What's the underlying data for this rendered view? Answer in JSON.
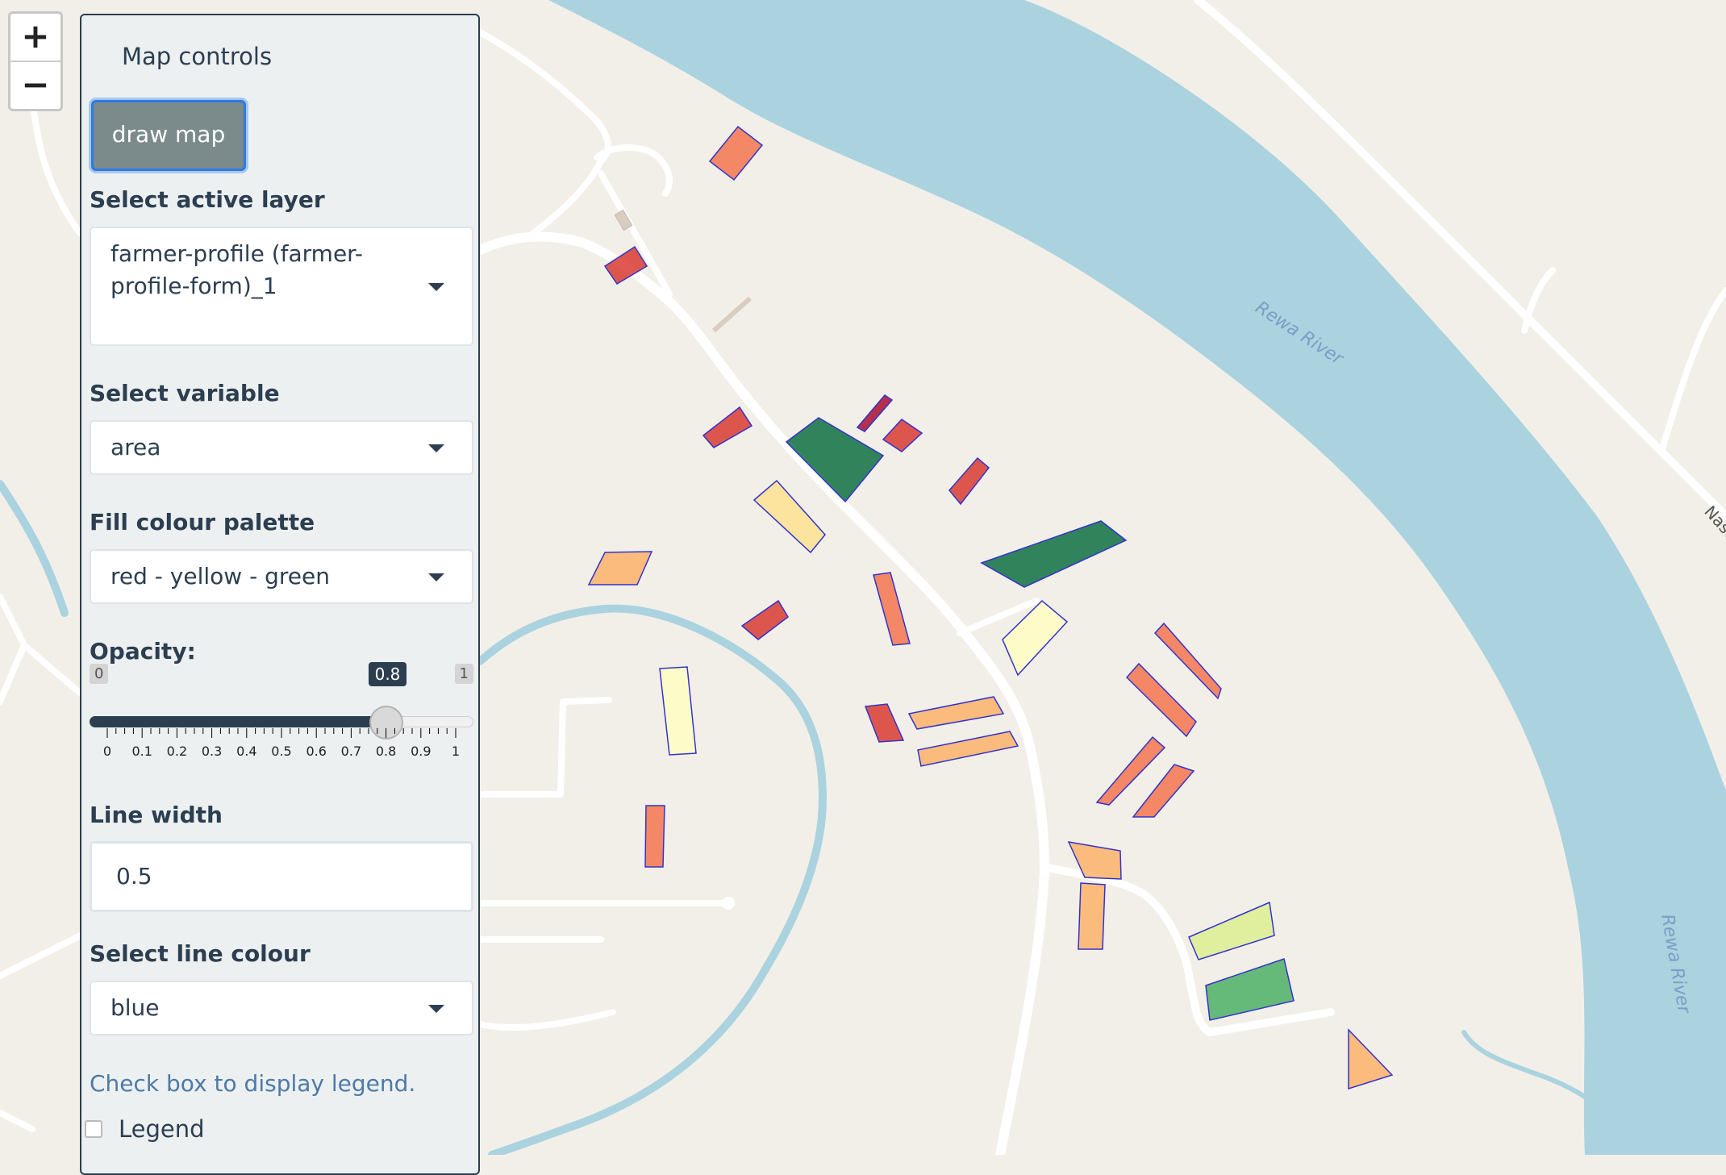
{
  "map": {
    "river_labels": [
      "Rewa River",
      "Rewa River"
    ],
    "road_label": "Naso",
    "polygon_fill_colors": [
      "#d73027",
      "#f46d43",
      "#fdae61",
      "#fee08b",
      "#ffffbf",
      "#d9ef8b",
      "#66bd63",
      "#1a9850"
    ],
    "polygon_line_color": "#3333cc"
  },
  "zoom": {
    "in_label": "+",
    "out_label": "−"
  },
  "panel": {
    "title": "Map controls",
    "draw_button": "draw map",
    "layer": {
      "label": "Select active layer",
      "value": "farmer-profile (farmer-profile-form)_1"
    },
    "variable": {
      "label": "Select variable",
      "value": "area"
    },
    "palette": {
      "label": "Fill colour palette",
      "value": "red - yellow - green"
    },
    "opacity": {
      "label": "Opacity:",
      "min": "0",
      "max": "1",
      "value": 0.8,
      "value_label": "0.8",
      "ticks": [
        "0",
        "0.1",
        "0.2",
        "0.3",
        "0.4",
        "0.5",
        "0.6",
        "0.7",
        "0.8",
        "0.9",
        "1"
      ]
    },
    "line_width": {
      "label": "Line width",
      "value": "0.5"
    },
    "line_colour": {
      "label": "Select line colour",
      "value": "blue"
    },
    "legend_hint": "Check box to display legend.",
    "legend_checkbox": {
      "label": "Legend",
      "checked": false
    }
  }
}
